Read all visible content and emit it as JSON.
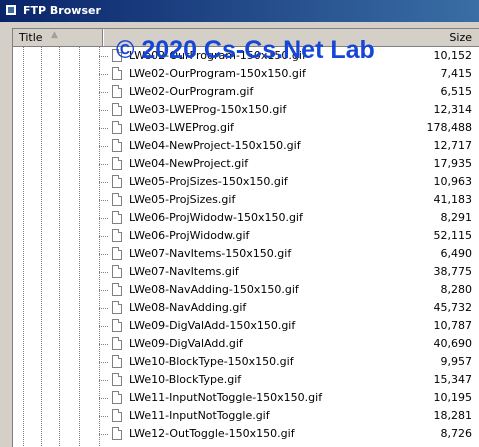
{
  "window": {
    "title": "FTP Browser"
  },
  "watermark": "© 2020 Cs-Cs.Net Lab",
  "columns": {
    "title": "Title",
    "sort_icon": "▲",
    "size": "Size"
  },
  "files": [
    {
      "name": "LWe02-OurProgram-150x150.gif",
      "size": "10,152"
    },
    {
      "name": "LWe02-OurProgram-150x150.gif",
      "size": "7,415"
    },
    {
      "name": "LWe02-OurProgram.gif",
      "size": "6,515"
    },
    {
      "name": "LWe03-LWEProg-150x150.gif",
      "size": "12,314"
    },
    {
      "name": "LWe03-LWEProg.gif",
      "size": "178,488"
    },
    {
      "name": "LWe04-NewProject-150x150.gif",
      "size": "12,717"
    },
    {
      "name": "LWe04-NewProject.gif",
      "size": "17,935"
    },
    {
      "name": "LWe05-ProjSizes-150x150.gif",
      "size": "10,963"
    },
    {
      "name": "LWe05-ProjSizes.gif",
      "size": "41,183"
    },
    {
      "name": "LWe06-ProjWidodw-150x150.gif",
      "size": "8,291"
    },
    {
      "name": "LWe06-ProjWidodw.gif",
      "size": "52,115"
    },
    {
      "name": "LWe07-NavItems-150x150.gif",
      "size": "6,490"
    },
    {
      "name": "LWe07-NavItems.gif",
      "size": "38,775"
    },
    {
      "name": "LWe08-NavAdding-150x150.gif",
      "size": "8,280"
    },
    {
      "name": "LWe08-NavAdding.gif",
      "size": "45,732"
    },
    {
      "name": "LWe09-DigValAdd-150x150.gif",
      "size": "10,787"
    },
    {
      "name": "LWe09-DigValAdd.gif",
      "size": "40,690"
    },
    {
      "name": "LWe10-BlockType-150x150.gif",
      "size": "9,957"
    },
    {
      "name": "LWe10-BlockType.gif",
      "size": "15,347"
    },
    {
      "name": "LWe11-InputNotToggle-150x150.gif",
      "size": "10,195"
    },
    {
      "name": "LWe11-InputNotToggle.gif",
      "size": "18,281"
    },
    {
      "name": "LWe12-OutToggle-150x150.gif",
      "size": "8,726"
    }
  ]
}
